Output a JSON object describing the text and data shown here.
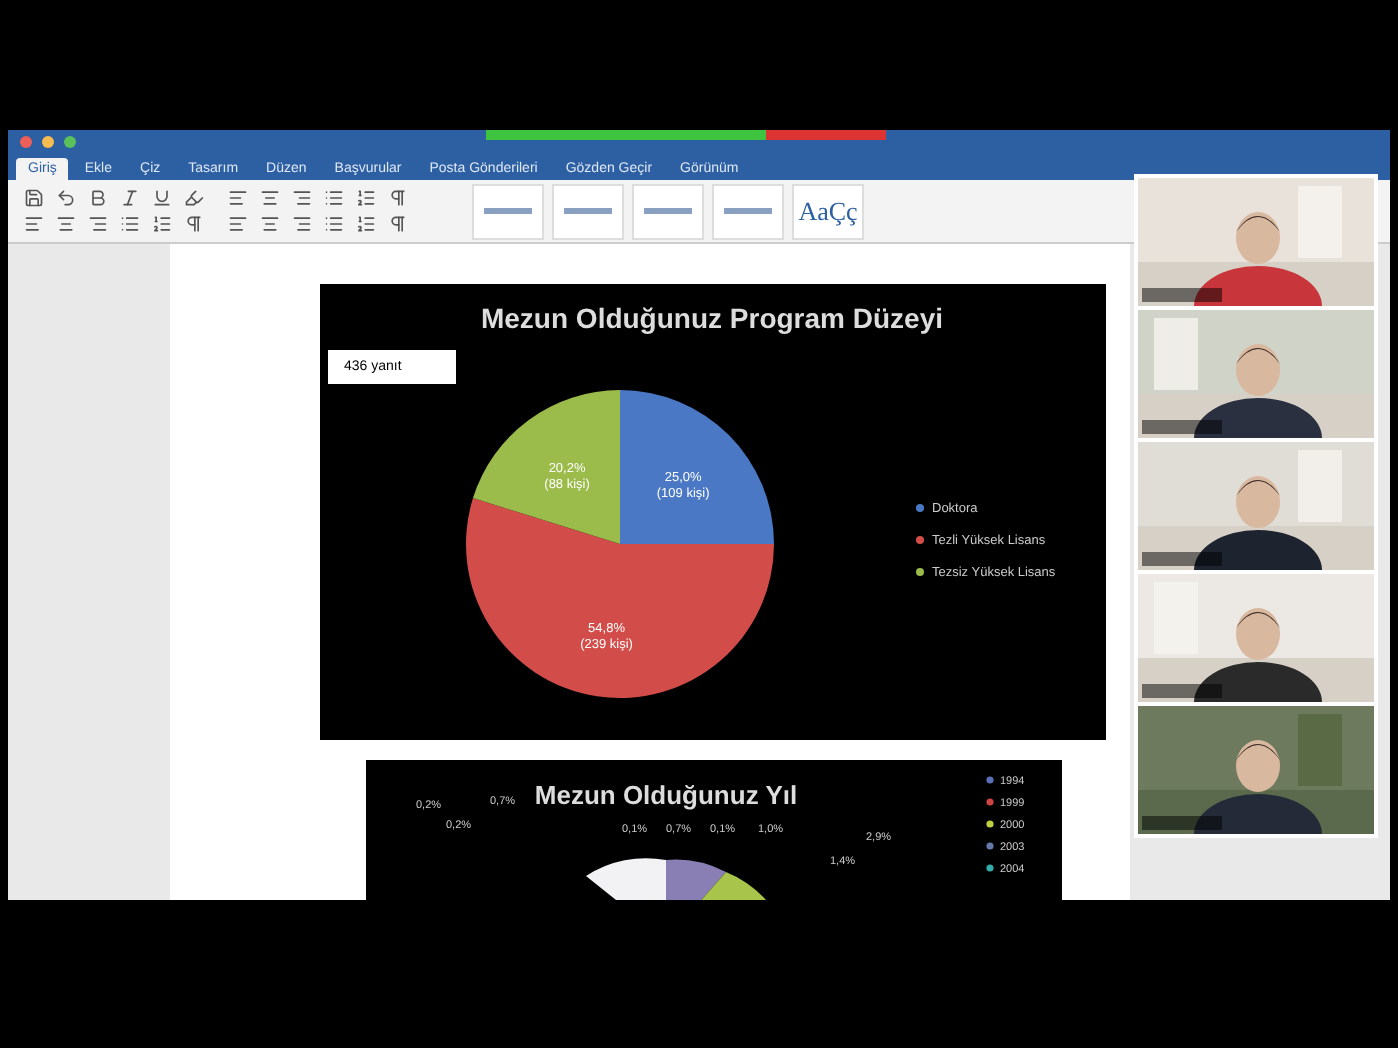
{
  "ribbon": {
    "tabs": [
      {
        "label": "Giriş",
        "selected": true
      },
      {
        "label": "Ekle",
        "selected": false
      },
      {
        "label": "Çiz",
        "selected": false
      },
      {
        "label": "Tasarım",
        "selected": false
      },
      {
        "label": "Düzen",
        "selected": false
      },
      {
        "label": "Başvurular",
        "selected": false
      },
      {
        "label": "Posta Gönderileri",
        "selected": false
      },
      {
        "label": "Gözden Geçir",
        "selected": false
      },
      {
        "label": "Görünüm",
        "selected": false
      }
    ],
    "style_sample": "AaÇç"
  },
  "document": {
    "charts": [
      {
        "response_count": "436 yanıt",
        "chart_data": {
          "type": "pie",
          "title": "Mezun Olduğunuz Program Düzeyi",
          "categories": [
            "Doktora",
            "Tezli Yüksek Lisans",
            "Tezsiz Yüksek Lisans"
          ],
          "values": [
            109,
            239,
            88
          ],
          "legend": "right",
          "value_labels": [
            "25,0% (109 kişi)",
            "54,8% (239 kişi)",
            "20,2% (88 kişi)"
          ]
        }
      }
    ],
    "second_chart": {
      "title": "Mezun Olduğunuz Yıl",
      "legend": [
        "1994",
        "1999",
        "2000",
        "2003",
        "2004"
      ],
      "labels": [
        "0,2%",
        "0,7%",
        "0,2%",
        "0,1%",
        "0,7%",
        "0,1%",
        "1,0%",
        "2,9%",
        "1,4%"
      ]
    }
  }
}
